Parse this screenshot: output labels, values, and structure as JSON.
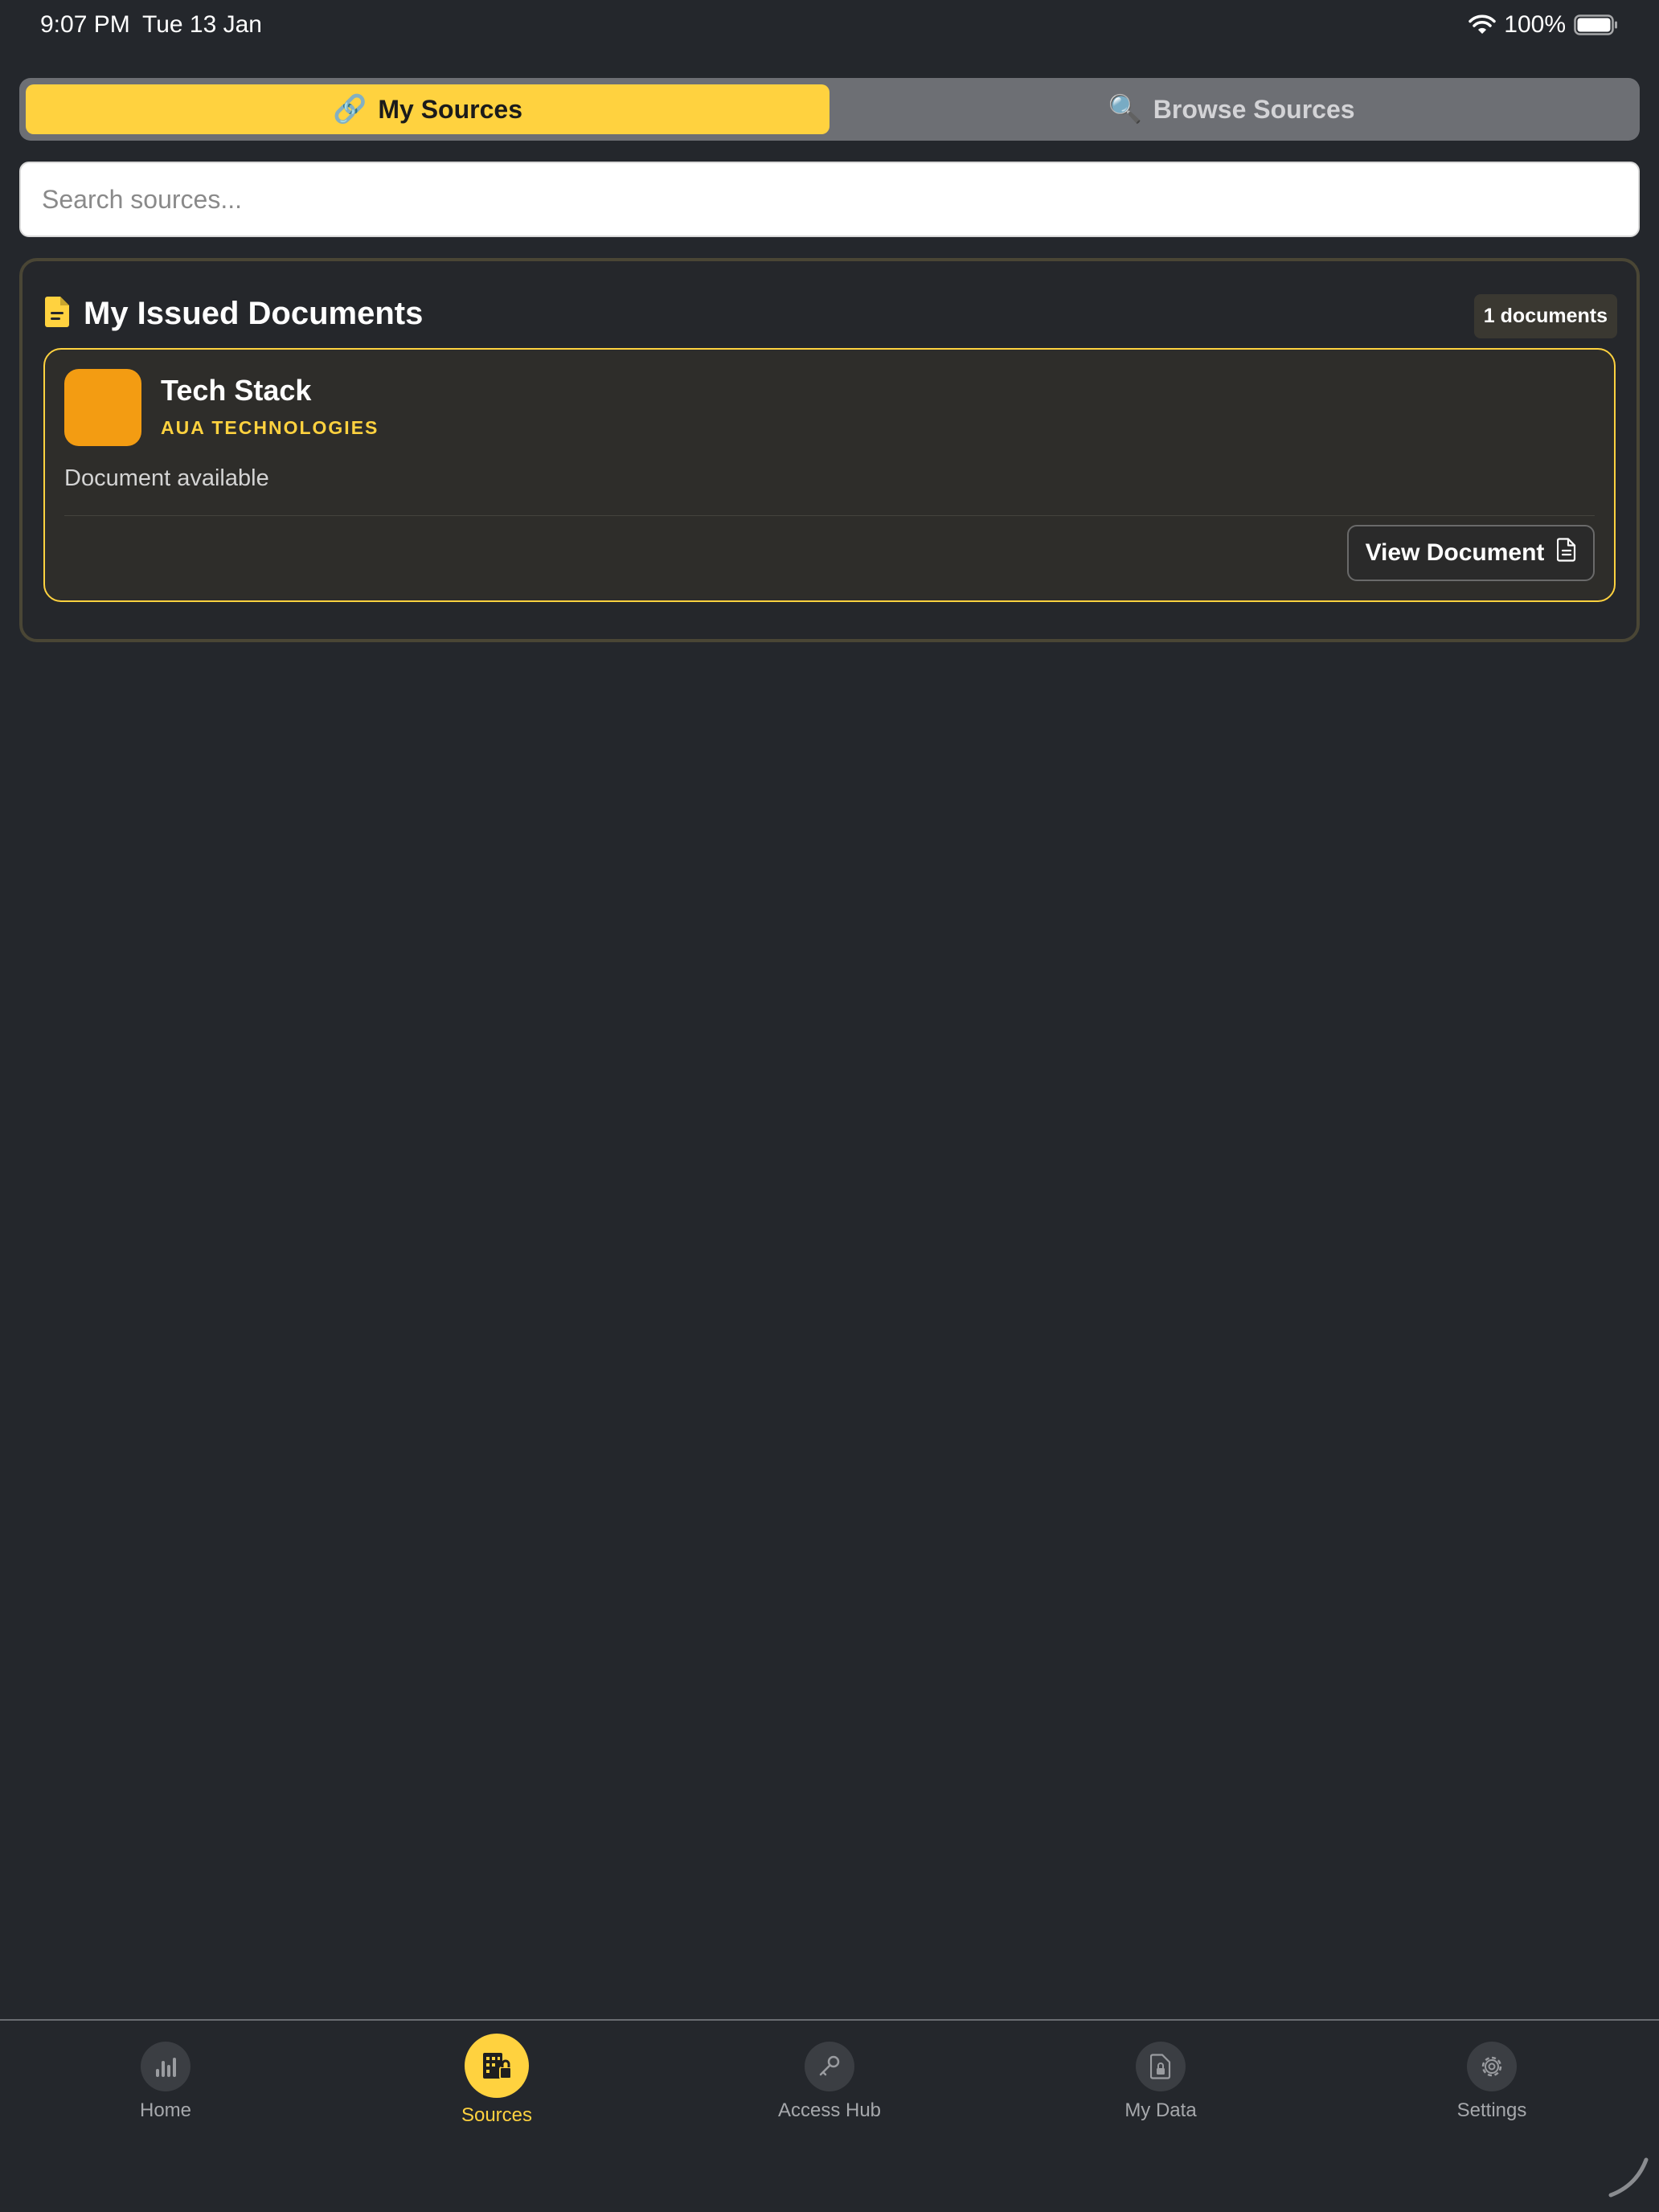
{
  "status_bar": {
    "time": "9:07 PM",
    "date": "Tue 13 Jan",
    "battery": "100%"
  },
  "tabs": {
    "my_sources": {
      "icon": "🔗",
      "label": "My Sources"
    },
    "browse_sources": {
      "icon": "🔍",
      "label": "Browse Sources"
    }
  },
  "search": {
    "placeholder": "Search sources..."
  },
  "section": {
    "title": "My Issued Documents",
    "count": "1 documents",
    "documents": [
      {
        "title": "Tech Stack",
        "issuer": "AUA TECHNOLOGIES",
        "status": "Document available",
        "action": "View Document"
      }
    ]
  },
  "nav": {
    "home": "Home",
    "sources": "Sources",
    "access_hub": "Access Hub",
    "my_data": "My Data",
    "settings": "Settings"
  },
  "colors": {
    "accent": "#ffd23f",
    "background": "#24272c",
    "thumbnail": "#f39c12"
  }
}
